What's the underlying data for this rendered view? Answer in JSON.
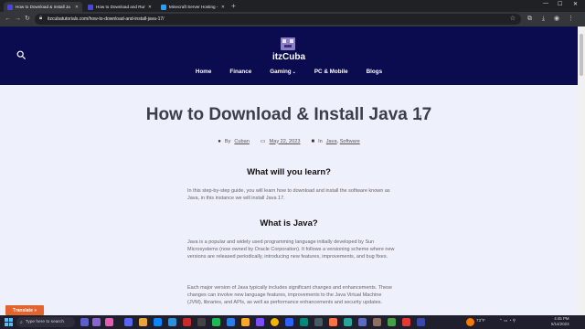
{
  "browser": {
    "tabs": [
      {
        "title": "How to Download & Install Ja",
        "active": true,
        "color": "#4b47d6"
      },
      {
        "title": "How to Download and Run a ",
        "active": false,
        "color": "#4b47d6"
      },
      {
        "title": "Minecraft Server Hosting - Apex",
        "active": false,
        "color": "#2a9df4"
      }
    ],
    "url": "itzcubatutorials.com/how-to-download-and-install-java-17/"
  },
  "site": {
    "brand": "itzCuba",
    "nav": [
      {
        "label": "Home"
      },
      {
        "label": "Finance"
      },
      {
        "label": "Gaming",
        "has_dropdown": true
      },
      {
        "label": "PC & Mobile"
      },
      {
        "label": "Blogs"
      }
    ],
    "colors": {
      "header_bg": "#0b0b4f",
      "translate_bg": "#e3642f"
    }
  },
  "article": {
    "title": "How to Download & Install Java 17",
    "meta": {
      "by_prefix": "By",
      "author": "Cuban",
      "date": "May 22, 2023",
      "in_prefix": "In",
      "categories": [
        "Java",
        "Software"
      ]
    },
    "sections": [
      {
        "heading": "What will you learn?",
        "paragraphs": [
          "In this step-by-step guide, you will learn how to download and install the software known as Java, in this instance we will install Java 17."
        ]
      },
      {
        "heading": "What is Java?",
        "paragraphs": [
          "Java is a popular and widely used programming language initially developed by Sun Microsystems (now owned by Oracle Corporation). It follows a versioning scheme where new versions are released periodically, introducing new features, improvements, and bug fixes.",
          "Each major version of Java typically includes significant changes and enhancements. These changes can involve new language features, improvements to the Java Virtual Machine (JVM), libraries, and APIs, as well as performance enhancements and security updates."
        ]
      }
    ]
  },
  "translate": {
    "label": "Translate »"
  },
  "taskbar": {
    "search_placeholder": "Type here to search",
    "weather": "73°F",
    "time": "4:45 PM",
    "date": "5/14/2023"
  }
}
